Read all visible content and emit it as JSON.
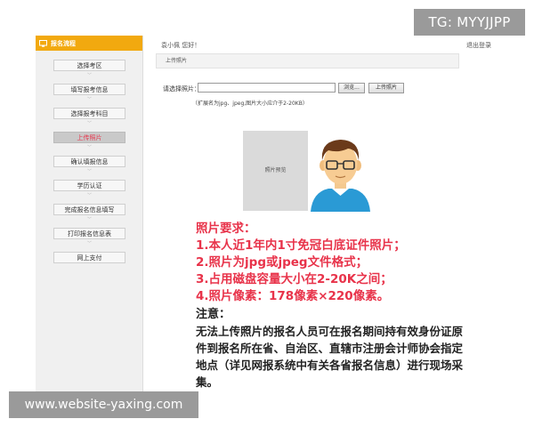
{
  "watermarks": {
    "top": "TG: MYYJJPP",
    "bottom": "www.website-yaxing.com"
  },
  "sidebar": {
    "title": "报名流程",
    "steps": [
      {
        "label": "选择考区",
        "active": false
      },
      {
        "label": "填写报考信息",
        "active": false
      },
      {
        "label": "选择报考科目",
        "active": false
      },
      {
        "label": "上传照片",
        "active": true
      },
      {
        "label": "确认填报信息",
        "active": false
      },
      {
        "label": "学历认证",
        "active": false
      },
      {
        "label": "完成报名信息填写",
        "active": false
      },
      {
        "label": "打印报名信息表",
        "active": false
      },
      {
        "label": "网上支付",
        "active": false
      }
    ]
  },
  "topbar": {
    "greeting": "袁小佩  您好！",
    "logout": "退出登录"
  },
  "section": {
    "title": "上传照片"
  },
  "upload": {
    "label": "请选择照片：",
    "input_value": "",
    "browse_label": "浏览...",
    "upload_label": "上传照片",
    "hint": "（扩展名为jpg、jpeg,图片大小应介于2-20KB）"
  },
  "photo": {
    "preview_label": "照片预览",
    "avatar_icon": "person-avatar-icon"
  },
  "requirements": {
    "title": "照片要求：",
    "items": [
      "1.本人近1年内1寸免冠白底证件照片；",
      "2.照片为jpg或jpeg文件格式；",
      "3.占用磁盘容量大小在2-20K之间；",
      "4.照片像素：178像素×220像素。"
    ]
  },
  "note": {
    "title": "注意：",
    "body": "无法上传照片的报名人员可在报名期间持有效身份证原件到报名所在省、自治区、直辖市注册会计师协会指定地点（详见网报系统中有关各省报名信息）进行现场采集。"
  },
  "colors": {
    "header_orange": "#f2a90f",
    "requirement_red": "#e8334a",
    "active_step_bg": "#c9c9c9"
  }
}
